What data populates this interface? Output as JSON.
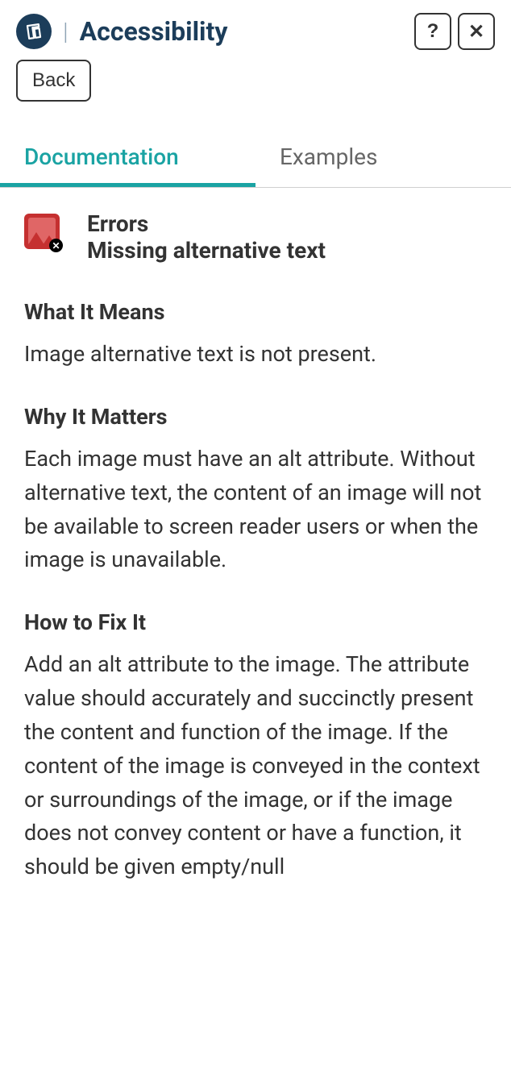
{
  "header": {
    "title": "Accessibility"
  },
  "back": {
    "label": "Back"
  },
  "tabs": {
    "documentation": "Documentation",
    "examples": "Examples"
  },
  "error": {
    "category": "Errors",
    "name": "Missing alternative text"
  },
  "sections": {
    "what": {
      "heading": "What It Means",
      "body": "Image alternative text is not present."
    },
    "why": {
      "heading": "Why It Matters",
      "body": "Each image must have an alt attribute. Without alternative text, the content of an image will not be available to screen reader users or when the image is unavailable."
    },
    "how": {
      "heading": "How to Fix It",
      "body": "Add an alt attribute to the image. The attribute value should accurately and succinctly present the content and function of the image. If the content of the image is conveyed in the context or surroundings of the image, or if the image does not convey content or have a function, it should be given empty/null"
    }
  }
}
